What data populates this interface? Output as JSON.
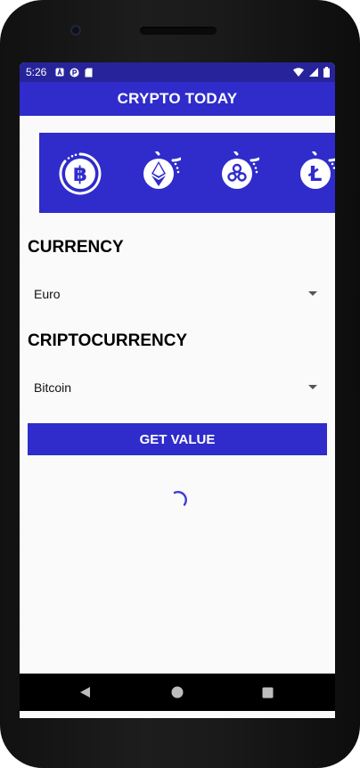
{
  "status_bar": {
    "time": "5:26",
    "icons": [
      "notification-a-icon",
      "notification-p-icon",
      "sd-card-icon",
      "wifi-icon",
      "signal-icon",
      "battery-icon"
    ]
  },
  "app_bar": {
    "title": "CRYPTO TODAY"
  },
  "carousel": {
    "items": [
      {
        "icon": "baht-coin-icon",
        "glyph": "฿"
      },
      {
        "icon": "ethereum-coin-icon"
      },
      {
        "icon": "ripple-coin-icon"
      },
      {
        "icon": "litecoin-coin-icon",
        "glyph": "Ł"
      }
    ]
  },
  "currency": {
    "heading": "CURRENCY",
    "selected": "Euro"
  },
  "cryptocurrency": {
    "heading": "CRIPTOCURRENCY",
    "selected": "Bitcoin"
  },
  "actions": {
    "get_value_label": "GET VALUE"
  },
  "colors": {
    "primary": "#2f2ccb",
    "status_bar": "#27249b",
    "background": "#fafafa",
    "spinner": "#3d3ad6"
  },
  "navigation": {
    "buttons": [
      "back-icon",
      "home-icon",
      "recents-icon"
    ]
  }
}
